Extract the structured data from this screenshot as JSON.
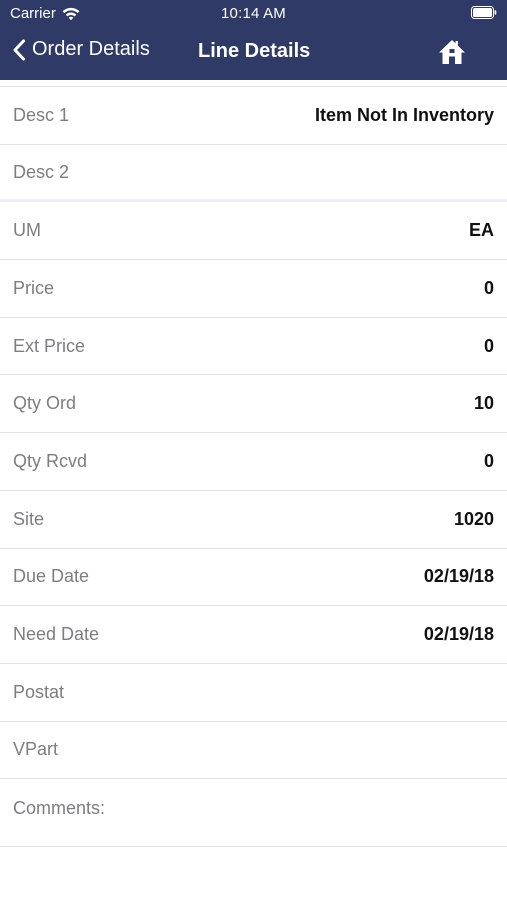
{
  "status_bar": {
    "carrier": "Carrier",
    "time": "10:14 AM",
    "icons": [
      "wifi-icon",
      "battery-icon"
    ]
  },
  "nav": {
    "back_label": "Order Details",
    "title": "Line Details",
    "home_icon": "home-icon"
  },
  "colors": {
    "header_bg": "#2f3a66",
    "label_text": "#7d7d82",
    "value_text": "#111111",
    "divider": "#e3e3e6"
  },
  "fields": [
    {
      "label": "Desc 1",
      "value": "Item Not In Inventory"
    },
    {
      "label": "Desc 2",
      "value": ""
    },
    {
      "label": "UM",
      "value": "EA"
    },
    {
      "label": "Price",
      "value": "0"
    },
    {
      "label": "Ext Price",
      "value": "0"
    },
    {
      "label": "Qty Ord",
      "value": "10"
    },
    {
      "label": "Qty Rcvd",
      "value": "0"
    },
    {
      "label": "Site",
      "value": "1020"
    },
    {
      "label": "Due Date",
      "value": "02/19/18"
    },
    {
      "label": "Need Date",
      "value": "02/19/18"
    },
    {
      "label": "Postat",
      "value": ""
    },
    {
      "label": "VPart",
      "value": ""
    },
    {
      "label": "Comments:",
      "value": ""
    }
  ]
}
